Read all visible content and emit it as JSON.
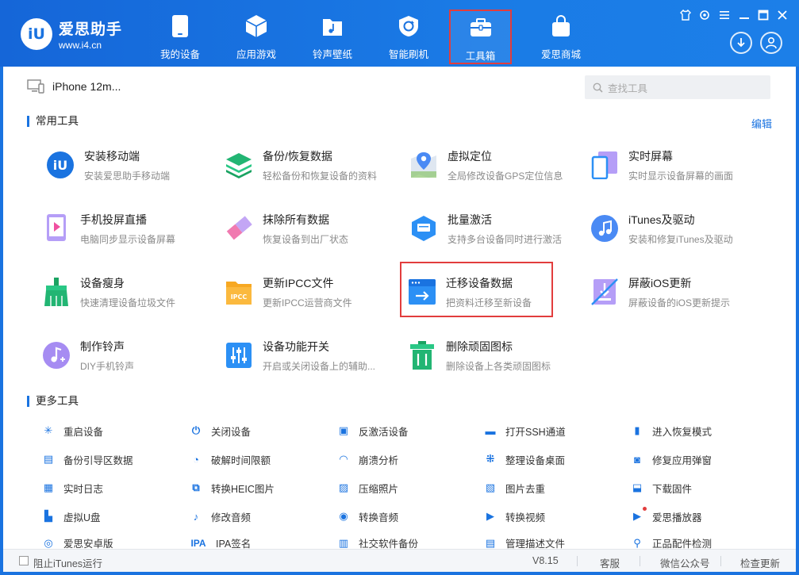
{
  "app": {
    "name": "爱思助手",
    "url": "www.i4.cn",
    "logo_mark": "iU"
  },
  "nav": [
    {
      "label": "我的设备",
      "icon": "phone-icon"
    },
    {
      "label": "应用游戏",
      "icon": "cube-icon"
    },
    {
      "label": "铃声壁纸",
      "icon": "music-folder-icon"
    },
    {
      "label": "智能刷机",
      "icon": "refresh-shield-icon"
    },
    {
      "label": "工具箱",
      "icon": "toolbox-icon",
      "active": true
    },
    {
      "label": "爱思商城",
      "icon": "shopping-bag-icon"
    }
  ],
  "device": {
    "name": "iPhone 12m..."
  },
  "search": {
    "placeholder": "查找工具"
  },
  "common_tools": {
    "title": "常用工具",
    "edit_label": "编辑",
    "items": [
      {
        "name": "安装移动端",
        "desc": "安装爱思助手移动端"
      },
      {
        "name": "备份/恢复数据",
        "desc": "轻松备份和恢复设备的资料"
      },
      {
        "name": "虚拟定位",
        "desc": "全局修改设备GPS定位信息"
      },
      {
        "name": "实时屏幕",
        "desc": "实时显示设备屏幕的画面"
      },
      {
        "name": "手机投屏直播",
        "desc": "电脑同步显示设备屏幕"
      },
      {
        "name": "抹除所有数据",
        "desc": "恢复设备到出厂状态"
      },
      {
        "name": "批量激活",
        "desc": "支持多台设备同时进行激活"
      },
      {
        "name": "iTunes及驱动",
        "desc": "安装和修复iTunes及驱动"
      },
      {
        "name": "设备瘦身",
        "desc": "快速清理设备垃圾文件"
      },
      {
        "name": "更新IPCC文件",
        "desc": "更新IPCC运营商文件",
        "icon_text": "IPCC"
      },
      {
        "name": "迁移设备数据",
        "desc": "把资料迁移至新设备"
      },
      {
        "name": "屏蔽iOS更新",
        "desc": "屏蔽设备的iOS更新提示"
      },
      {
        "name": "制作铃声",
        "desc": "DIY手机铃声"
      },
      {
        "name": "设备功能开关",
        "desc": "开启或关闭设备上的辅助..."
      },
      {
        "name": "删除顽固图标",
        "desc": "删除设备上各类顽固图标"
      }
    ]
  },
  "more_tools": {
    "title": "更多工具",
    "items": [
      {
        "label": "重启设备",
        "icon": "restart-icon"
      },
      {
        "label": "关闭设备",
        "icon": "power-icon"
      },
      {
        "label": "反激活设备",
        "icon": "deactivate-icon"
      },
      {
        "label": "打开SSH通道",
        "icon": "ssh-icon"
      },
      {
        "label": "进入恢复模式",
        "icon": "recovery-icon"
      },
      {
        "label": "备份引导区数据",
        "icon": "backup-boot-icon"
      },
      {
        "label": "破解时间限额",
        "icon": "clock-icon"
      },
      {
        "label": "崩溃分析",
        "icon": "crash-analysis-icon"
      },
      {
        "label": "整理设备桌面",
        "icon": "grid-icon"
      },
      {
        "label": "修复应用弹窗",
        "icon": "repair-popup-icon"
      },
      {
        "label": "实时日志",
        "icon": "log-icon"
      },
      {
        "label": "转换HEIC图片",
        "icon": "heic-convert-icon"
      },
      {
        "label": "压缩照片",
        "icon": "compress-photo-icon"
      },
      {
        "label": "图片去重",
        "icon": "dedupe-icon"
      },
      {
        "label": "下载固件",
        "icon": "download-firmware-icon"
      },
      {
        "label": "虚拟U盘",
        "icon": "usb-drive-icon"
      },
      {
        "label": "修改音频",
        "icon": "edit-audio-icon"
      },
      {
        "label": "转换音频",
        "icon": "convert-audio-icon"
      },
      {
        "label": "转换视频",
        "icon": "convert-video-icon"
      },
      {
        "label": "爱思播放器",
        "icon": "player-icon"
      },
      {
        "label": "爱思安卓版",
        "icon": "android-icon"
      },
      {
        "label": "IPA签名",
        "icon": "ipa-sign-icon",
        "icon_text": "IPA"
      },
      {
        "label": "社交软件备份",
        "icon": "social-backup-icon"
      },
      {
        "label": "管理描述文件",
        "icon": "profile-icon"
      },
      {
        "label": "正品配件检测",
        "icon": "accessory-check-icon"
      }
    ]
  },
  "footer": {
    "block_itunes": "阻止iTunes运行",
    "version": "V8.15",
    "service": "客服",
    "wechat": "微信公众号",
    "check_update": "检查更新"
  },
  "colors": {
    "brand": "#1a73e0",
    "highlight": "#e23d3d"
  }
}
